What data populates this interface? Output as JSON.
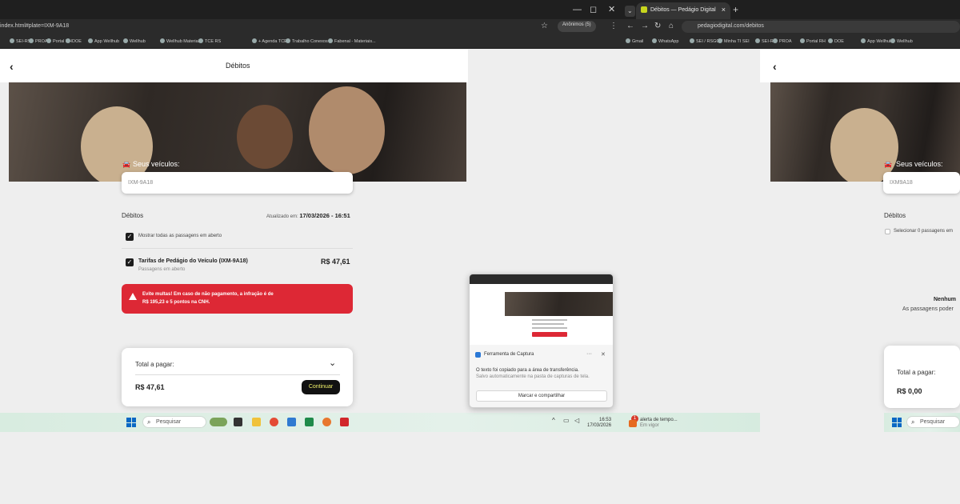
{
  "window": {
    "minimize": "—",
    "restore": "◻",
    "close": "✕"
  },
  "browser": {
    "left_url": "index.html#plate=IXM-9A18",
    "left_profile": "Anônimos (5)",
    "tab_title": "Débitos — Pedágio Digital",
    "right_url": "pedagiodigital.com/debitos",
    "bookmarks_left": [
      "SEI-RS",
      "PROA",
      "Portal RH",
      "DOE",
      "App Wellhub",
      "Wellhub",
      "Wellhub Materiais",
      "TCE RS",
      "+ Agenda TCE",
      "Trabalho Conexos",
      "Fabenal - Materiais..."
    ],
    "bookmarks_right": [
      "Gmail",
      "WhatsApp",
      "SEI / RSGOV",
      "Minha TI SEI",
      "SEI-RS",
      "PROA",
      "Portal RH",
      "DOE",
      "App Wellhub",
      "Wellhub"
    ]
  },
  "left_app": {
    "header_title": "Débitos",
    "vehicles_label": "Seus veículos:",
    "plate_value": "IXM-9A18",
    "debits_title": "Débitos",
    "updated_label": "Atualizado em:",
    "updated_value": "17/03/2026 - 16:51",
    "show_all_label": "Mostrar todas as passagens em aberto",
    "item_title": "Tarifas de Pedágio do Veículo (IXM-9A18)",
    "item_subtitle": "Passagens em aberto",
    "item_amount": "R$ 47,61",
    "alert_line1": "Evite multas! Em caso de não pagamento, a infração é de",
    "alert_line2": "R$ 195,23 e 5 pontos na CNH.",
    "total_label": "Total a pagar:",
    "total_value": "R$ 47,61",
    "continue_label": "Continuar"
  },
  "right_app": {
    "vehicles_label": "Seus veículos:",
    "plate_value": "IXM9A18",
    "debits_title": "Débitos",
    "select_label": "Selecionar 0 passagens em",
    "empty_title": "Nenhum",
    "empty_sub": "As passagens poder",
    "total_label": "Total a pagar:",
    "total_value": "R$ 0,00"
  },
  "snip": {
    "title": "Ferramenta de Captura",
    "msg1": "O texto foi copiado para a área de transferência.",
    "msg2": "Salvo automaticamente na pasta de capturas de tela.",
    "button": "Marcar e compartilhar"
  },
  "taskbar": {
    "search": "Pesquisar",
    "time": "16:53",
    "date": "17/03/2026",
    "notif_badge": "1",
    "notif_title": "alerta de tempo...",
    "notif_sub": "Em vigor",
    "search_right": "Pesquisar"
  }
}
